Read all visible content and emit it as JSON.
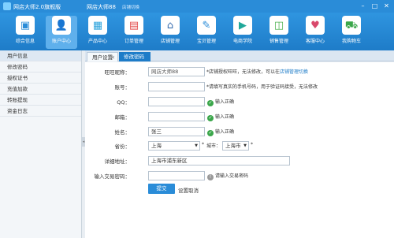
{
  "titlebar": {
    "app_title": "网店大师2.0旗舰版",
    "shop_name": "网店大师88",
    "switch_text": "店铺切换",
    "min": "–",
    "max": "□",
    "close": "✕"
  },
  "toolbar": {
    "items": [
      {
        "label": "综合信息",
        "icon": "▣",
        "color": "#2a8cd8"
      },
      {
        "label": "账户中心",
        "icon": "👤",
        "color": "#e07b39"
      },
      {
        "label": "产品中心",
        "icon": "▦",
        "color": "#2ba3dc"
      },
      {
        "label": "订单管理",
        "icon": "▤",
        "color": "#e24a4a"
      },
      {
        "label": "店铺管理",
        "icon": "⌂",
        "color": "#3a6fb0"
      },
      {
        "label": "宝贝管理",
        "icon": "✎",
        "color": "#2a8cd8"
      },
      {
        "label": "电商学院",
        "icon": "▶",
        "color": "#1fa89a"
      },
      {
        "label": "销售管理",
        "icon": "◫",
        "color": "#4bb04f"
      },
      {
        "label": "客服中心",
        "icon": "♥",
        "color": "#d9486b"
      },
      {
        "label": "我购物车",
        "icon": "⛟",
        "color": "#3aa64a"
      }
    ]
  },
  "sidebar": {
    "items": [
      "用户信息",
      "修改密码",
      "授权证书",
      "充值加款",
      "转账提现",
      "资金日志"
    ]
  },
  "tabs": {
    "tab1": "用户设置",
    "tab1_close": "✕",
    "tab2": "修改密码"
  },
  "form": {
    "wangwang": {
      "label": "旺旺昵称：",
      "value": "网店大师88",
      "note_prefix": "*店铺授权旺旺，无法修改，可以在",
      "note_link": "店铺管理切换"
    },
    "account": {
      "label": "账号：",
      "value": "",
      "note": "*请填写真实的手机号码，用于验证码接受，无法修改"
    },
    "qq": {
      "label": "QQ：",
      "value": "",
      "ok": "输入正确"
    },
    "email": {
      "label": "邮箱：",
      "value": "",
      "ok": "输入正确"
    },
    "name": {
      "label": "姓名：",
      "value": "张三",
      "ok": "输入正确"
    },
    "province": {
      "label": "省份：",
      "value": "上海"
    },
    "city": {
      "label": "城市：",
      "value": "上海市"
    },
    "address": {
      "label": "详细地址：",
      "value": "上海市浦东新区"
    },
    "trade_pwd": {
      "label": "输入交易密码：",
      "value": "",
      "hint": "请输入交易密码"
    },
    "submit": "提交",
    "reset": "设置取消"
  }
}
